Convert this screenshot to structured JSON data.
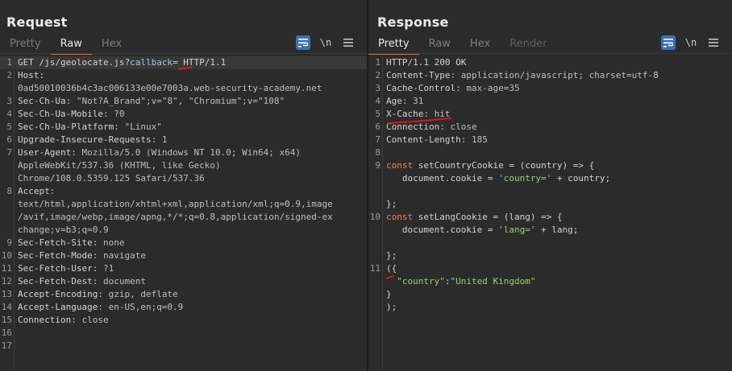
{
  "request": {
    "title": "Request",
    "tabs": [
      {
        "label": "Pretty",
        "active": false
      },
      {
        "label": "Raw",
        "active": true
      },
      {
        "label": "Hex",
        "active": false
      }
    ],
    "tool_newline": "\\n",
    "lines": [
      {
        "n": "1",
        "parts": [
          {
            "t": "GET /js/geolocate.js?",
            "c": "punct"
          },
          {
            "t": "callback",
            "c": "blue"
          },
          {
            "t": "= HTTP/1.1",
            "c": "punct"
          }
        ]
      },
      {
        "n": "2",
        "parts": [
          {
            "t": "Host:",
            "c": "hdr-name"
          }
        ]
      },
      {
        "n": "",
        "parts": [
          {
            "t": "0ad50010036b4c3ac006133e00e7003a.web-security-academy.net",
            "c": "hdr-val"
          }
        ]
      },
      {
        "n": "3",
        "parts": [
          {
            "t": "Sec-Ch-Ua",
            "c": "hdr-name"
          },
          {
            "t": ": \"Not?A_Brand\";v=\"8\", \"Chromium\";v=\"108\"",
            "c": "hdr-val"
          }
        ]
      },
      {
        "n": "4",
        "parts": [
          {
            "t": "Sec-Ch-Ua-Mobile",
            "c": "hdr-name"
          },
          {
            "t": ": ?0",
            "c": "hdr-val"
          }
        ]
      },
      {
        "n": "5",
        "parts": [
          {
            "t": "Sec-Ch-Ua-Platform",
            "c": "hdr-name"
          },
          {
            "t": ": \"Linux\"",
            "c": "hdr-val"
          }
        ]
      },
      {
        "n": "6",
        "parts": [
          {
            "t": "Upgrade-Insecure-Requests",
            "c": "hdr-name"
          },
          {
            "t": ": 1",
            "c": "hdr-val"
          }
        ]
      },
      {
        "n": "7",
        "parts": [
          {
            "t": "User-Agent",
            "c": "hdr-name"
          },
          {
            "t": ": Mozilla/5.0 (Windows NT 10.0; Win64; x64)",
            "c": "hdr-val"
          }
        ]
      },
      {
        "n": "",
        "parts": [
          {
            "t": "AppleWebKit/537.36 (KHTML, like Gecko)",
            "c": "hdr-val"
          }
        ]
      },
      {
        "n": "",
        "parts": [
          {
            "t": "Chrome/108.0.5359.125 Safari/537.36",
            "c": "hdr-val"
          }
        ]
      },
      {
        "n": "8",
        "parts": [
          {
            "t": "Accept",
            "c": "hdr-name"
          },
          {
            "t": ":",
            "c": "hdr-val"
          }
        ]
      },
      {
        "n": "",
        "parts": [
          {
            "t": "text/html,application/xhtml+xml,application/xml;q=0.9,image",
            "c": "hdr-val"
          }
        ]
      },
      {
        "n": "",
        "parts": [
          {
            "t": "/avif,image/webp,image/apng,*/*;q=0.8,application/signed-ex",
            "c": "hdr-val"
          }
        ]
      },
      {
        "n": "",
        "parts": [
          {
            "t": "change;v=b3;q=0.9",
            "c": "hdr-val"
          }
        ]
      },
      {
        "n": "9",
        "parts": [
          {
            "t": "Sec-Fetch-Site",
            "c": "hdr-name"
          },
          {
            "t": ": none",
            "c": "hdr-val"
          }
        ]
      },
      {
        "n": "10",
        "parts": [
          {
            "t": "Sec-Fetch-Mode",
            "c": "hdr-name"
          },
          {
            "t": ": navigate",
            "c": "hdr-val"
          }
        ]
      },
      {
        "n": "11",
        "parts": [
          {
            "t": "Sec-Fetch-User",
            "c": "hdr-name"
          },
          {
            "t": ": ?1",
            "c": "hdr-val"
          }
        ]
      },
      {
        "n": "12",
        "parts": [
          {
            "t": "Sec-Fetch-Dest",
            "c": "hdr-name"
          },
          {
            "t": ": document",
            "c": "hdr-val"
          }
        ]
      },
      {
        "n": "13",
        "parts": [
          {
            "t": "Accept-Encoding",
            "c": "hdr-name"
          },
          {
            "t": ": gzip, deflate",
            "c": "hdr-val"
          }
        ]
      },
      {
        "n": "14",
        "parts": [
          {
            "t": "Accept-Language",
            "c": "hdr-name"
          },
          {
            "t": ": en-US,en;q=0.9",
            "c": "hdr-val"
          }
        ]
      },
      {
        "n": "15",
        "parts": [
          {
            "t": "Connection",
            "c": "hdr-name"
          },
          {
            "t": ": close",
            "c": "hdr-val"
          }
        ]
      },
      {
        "n": "16",
        "parts": []
      },
      {
        "n": "17",
        "parts": []
      }
    ]
  },
  "response": {
    "title": "Response",
    "tabs": [
      {
        "label": "Pretty",
        "active": true
      },
      {
        "label": "Raw",
        "active": false
      },
      {
        "label": "Hex",
        "active": false
      },
      {
        "label": "Render",
        "active": false,
        "disabled": true
      }
    ],
    "tool_newline": "\\n",
    "lines": [
      {
        "n": "1",
        "parts": [
          {
            "t": "HTTP/1.1 200 OK",
            "c": "punct"
          }
        ]
      },
      {
        "n": "2",
        "parts": [
          {
            "t": "Content-Type",
            "c": "hdr-name"
          },
          {
            "t": ": application/javascript; charset=utf-8",
            "c": "hdr-val"
          }
        ]
      },
      {
        "n": "3",
        "parts": [
          {
            "t": "Cache-Control",
            "c": "hdr-name"
          },
          {
            "t": ": max-age=35",
            "c": "hdr-val"
          }
        ]
      },
      {
        "n": "4",
        "parts": [
          {
            "t": "Age",
            "c": "hdr-name"
          },
          {
            "t": ": 31",
            "c": "hdr-val"
          }
        ]
      },
      {
        "n": "5",
        "parts": [
          {
            "t": "X-Cache",
            "c": "hdr-name"
          },
          {
            "t": ": hit",
            "c": "hdr-val"
          }
        ]
      },
      {
        "n": "6",
        "parts": [
          {
            "t": "Connection",
            "c": "hdr-name"
          },
          {
            "t": ": close",
            "c": "hdr-val"
          }
        ]
      },
      {
        "n": "7",
        "parts": [
          {
            "t": "Content-Length",
            "c": "hdr-name"
          },
          {
            "t": ": 185",
            "c": "hdr-val"
          }
        ]
      },
      {
        "n": "8",
        "parts": []
      },
      {
        "n": "9",
        "parts": [
          {
            "t": "const",
            "c": "kw"
          },
          {
            "t": " setCountryCookie = (country) => {",
            "c": "punct"
          }
        ]
      },
      {
        "n": "",
        "parts": [
          {
            "t": "   document.cookie = ",
            "c": "punct"
          },
          {
            "t": "'country='",
            "c": "str"
          },
          {
            "t": " + country;",
            "c": "punct"
          }
        ]
      },
      {
        "n": "",
        "parts": []
      },
      {
        "n": "",
        "parts": [
          {
            "t": "};",
            "c": "punct"
          }
        ]
      },
      {
        "n": "10",
        "parts": [
          {
            "t": "const",
            "c": "kw"
          },
          {
            "t": " setLangCookie = (lang) => {",
            "c": "punct"
          }
        ]
      },
      {
        "n": "",
        "parts": [
          {
            "t": "   document.cookie = ",
            "c": "punct"
          },
          {
            "t": "'lang='",
            "c": "str"
          },
          {
            "t": " + lang;",
            "c": "punct"
          }
        ]
      },
      {
        "n": "",
        "parts": []
      },
      {
        "n": "",
        "parts": [
          {
            "t": "};",
            "c": "punct"
          }
        ]
      },
      {
        "n": "11",
        "parts": [
          {
            "t": "({",
            "c": "punct"
          }
        ]
      },
      {
        "n": "",
        "parts": [
          {
            "t": "  ",
            "c": "punct"
          },
          {
            "t": "\"country\"",
            "c": "str"
          },
          {
            "t": ":",
            "c": "punct"
          },
          {
            "t": "\"United Kingdom\"",
            "c": "str"
          }
        ]
      },
      {
        "n": "",
        "parts": [
          {
            "t": "}",
            "c": "punct"
          }
        ]
      },
      {
        "n": "",
        "parts": [
          {
            "t": ");",
            "c": "punct"
          }
        ]
      }
    ]
  },
  "colors": {
    "accent_tab": "#e8663a",
    "active_tool": "#3e6fb5",
    "annotation": "#e0102a"
  },
  "icons": {
    "wrap": "wrap-text-icon",
    "menu": "hamburger-menu-icon",
    "layout": [
      "split-horizontal-icon",
      "split-vertical-icon",
      "single-pane-icon"
    ]
  }
}
